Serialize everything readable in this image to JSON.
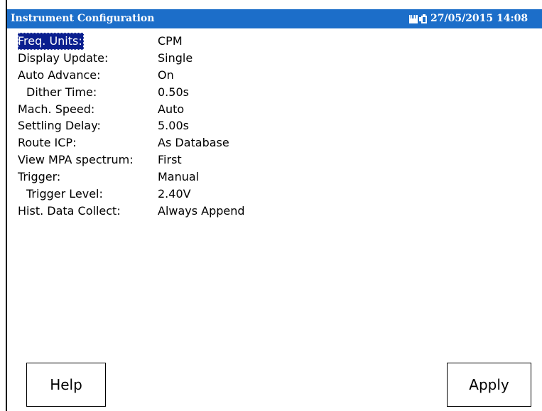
{
  "window": {
    "title": "Instrument Configuration",
    "datetime": "27/05/2015 14:08",
    "title_bar_color": "#1c6ec9"
  },
  "status_icons": [
    "memory-card-icon",
    "battery-charging-icon"
  ],
  "settings": [
    {
      "label": "Freq. Units:",
      "value": "CPM",
      "selected": true,
      "indent": false
    },
    {
      "label": "Display Update:",
      "value": "Single",
      "selected": false,
      "indent": false
    },
    {
      "label": "Auto Advance:",
      "value": "On",
      "selected": false,
      "indent": false
    },
    {
      "label": "Dither Time:",
      "value": "0.50s",
      "selected": false,
      "indent": true
    },
    {
      "label": "Mach. Speed:",
      "value": "Auto",
      "selected": false,
      "indent": false
    },
    {
      "label": "Settling Delay:",
      "value": "5.00s",
      "selected": false,
      "indent": false
    },
    {
      "label": "Route ICP:",
      "value": "As Database",
      "selected": false,
      "indent": false
    },
    {
      "label": "View MPA spectrum:",
      "value": "First",
      "selected": false,
      "indent": false
    },
    {
      "label": "Trigger:",
      "value": "Manual",
      "selected": false,
      "indent": false
    },
    {
      "label": "Trigger Level:",
      "value": "2.40V",
      "selected": false,
      "indent": true
    },
    {
      "label": "Hist. Data Collect:",
      "value": "Always Append",
      "selected": false,
      "indent": false
    }
  ],
  "buttons": {
    "help_label": "Help",
    "apply_label": "Apply"
  },
  "colors": {
    "selection_background": "#0a1f8f"
  }
}
